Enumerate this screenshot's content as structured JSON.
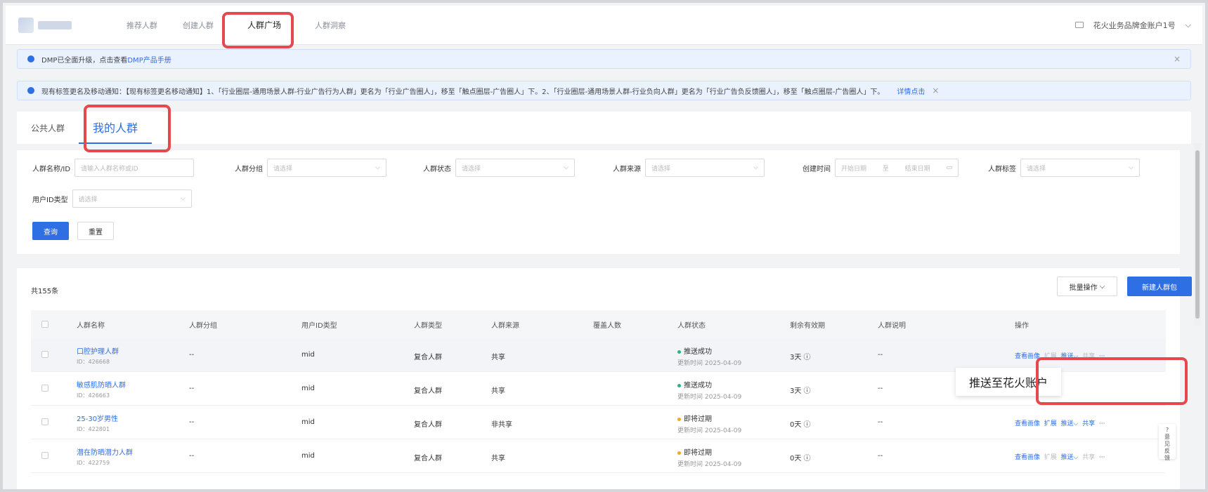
{
  "nav": {
    "items": [
      "推荐人群",
      "创建人群",
      "人群广场",
      "人群洞察"
    ],
    "active_index": 2,
    "account": "花火业务品牌金账户1号"
  },
  "notices": [
    {
      "text": "DMP已全面升级，点击查看",
      "link": "DMP产品手册"
    },
    {
      "text": "现有标签更名及移动通知：【现有标签更名移动通知】1、「行业圈层-通用场景人群-行业广告行为人群」更名为「行业广告圈人」，移至「触点圈层-广告圈人」下。2、「行业圈层-通用场景人群-行业负向人群」更名为「行业广告负反馈圈人」，移至「触点圈层-广告圈人」下。",
      "link": "详情点击"
    }
  ],
  "tabs": [
    "公共人群",
    "我的人群"
  ],
  "filters": {
    "name_label": "人群名称/ID",
    "name_placeholder": "请输入人群名称或ID",
    "group_label": "人群分组",
    "group_placeholder": "请选择",
    "status_label": "人群状态",
    "status_placeholder": "请选择",
    "source_label": "人群来源",
    "source_placeholder": "请选择",
    "time_label": "创建时间",
    "time_start": "开始日期",
    "time_sep": "至",
    "time_end": "结束日期",
    "tag_label": "人群标签",
    "tag_placeholder": "请选择",
    "idtype_label": "用户ID类型",
    "idtype_placeholder": "请选择",
    "query_btn": "查询",
    "reset_btn": "重置"
  },
  "table": {
    "total": "共155条",
    "batch_btn": "批量操作",
    "new_btn": "新建人群包",
    "headers": [
      "人群名称",
      "人群分组",
      "用户ID类型",
      "人群类型",
      "人群来源",
      "覆盖人数",
      "人群状态",
      "剩余有效期",
      "人群说明",
      "操作"
    ],
    "rows": [
      {
        "name": "口腔护理人群",
        "id": "ID：426668",
        "group": "--",
        "idtype": "mid",
        "type": "复合人群",
        "source": "共享",
        "status": "推送成功",
        "status_color": "#2bb673",
        "updated": "更新时间  2025-04-09",
        "validity": "3天 ⓘ",
        "desc": "--"
      },
      {
        "name": "敏感肌防晒人群",
        "id": "ID：426663",
        "group": "--",
        "idtype": "mid",
        "type": "复合人群",
        "source": "共享",
        "status": "推送成功",
        "status_color": "#2bb673",
        "updated": "更新时间  2025-04-09",
        "validity": "3天 ⓘ",
        "desc": "--"
      },
      {
        "name": "25-30岁男性",
        "id": "ID：422801",
        "group": "--",
        "idtype": "mid",
        "type": "复合人群",
        "source": "非共享",
        "status": "即将过期",
        "status_color": "#f5a623",
        "updated": "更新时间  2025-04-09",
        "validity": "0天 ⓘ",
        "desc": "--"
      },
      {
        "name": "潜在防晒潜力人群",
        "id": "ID：422759",
        "group": "--",
        "idtype": "mid",
        "type": "复合人群",
        "source": "共享",
        "status": "即将过期",
        "status_color": "#f5a623",
        "updated": "更新时间  2025-04-09",
        "validity": "0天 ⓘ",
        "desc": "--"
      }
    ],
    "ops": {
      "view": "查看画像",
      "expand": "扩展",
      "push": "推送",
      "share": "共享",
      "more": "···"
    }
  },
  "popup": {
    "text": "推送至花火账户"
  },
  "feedback": {
    "text": "意见反馈"
  }
}
